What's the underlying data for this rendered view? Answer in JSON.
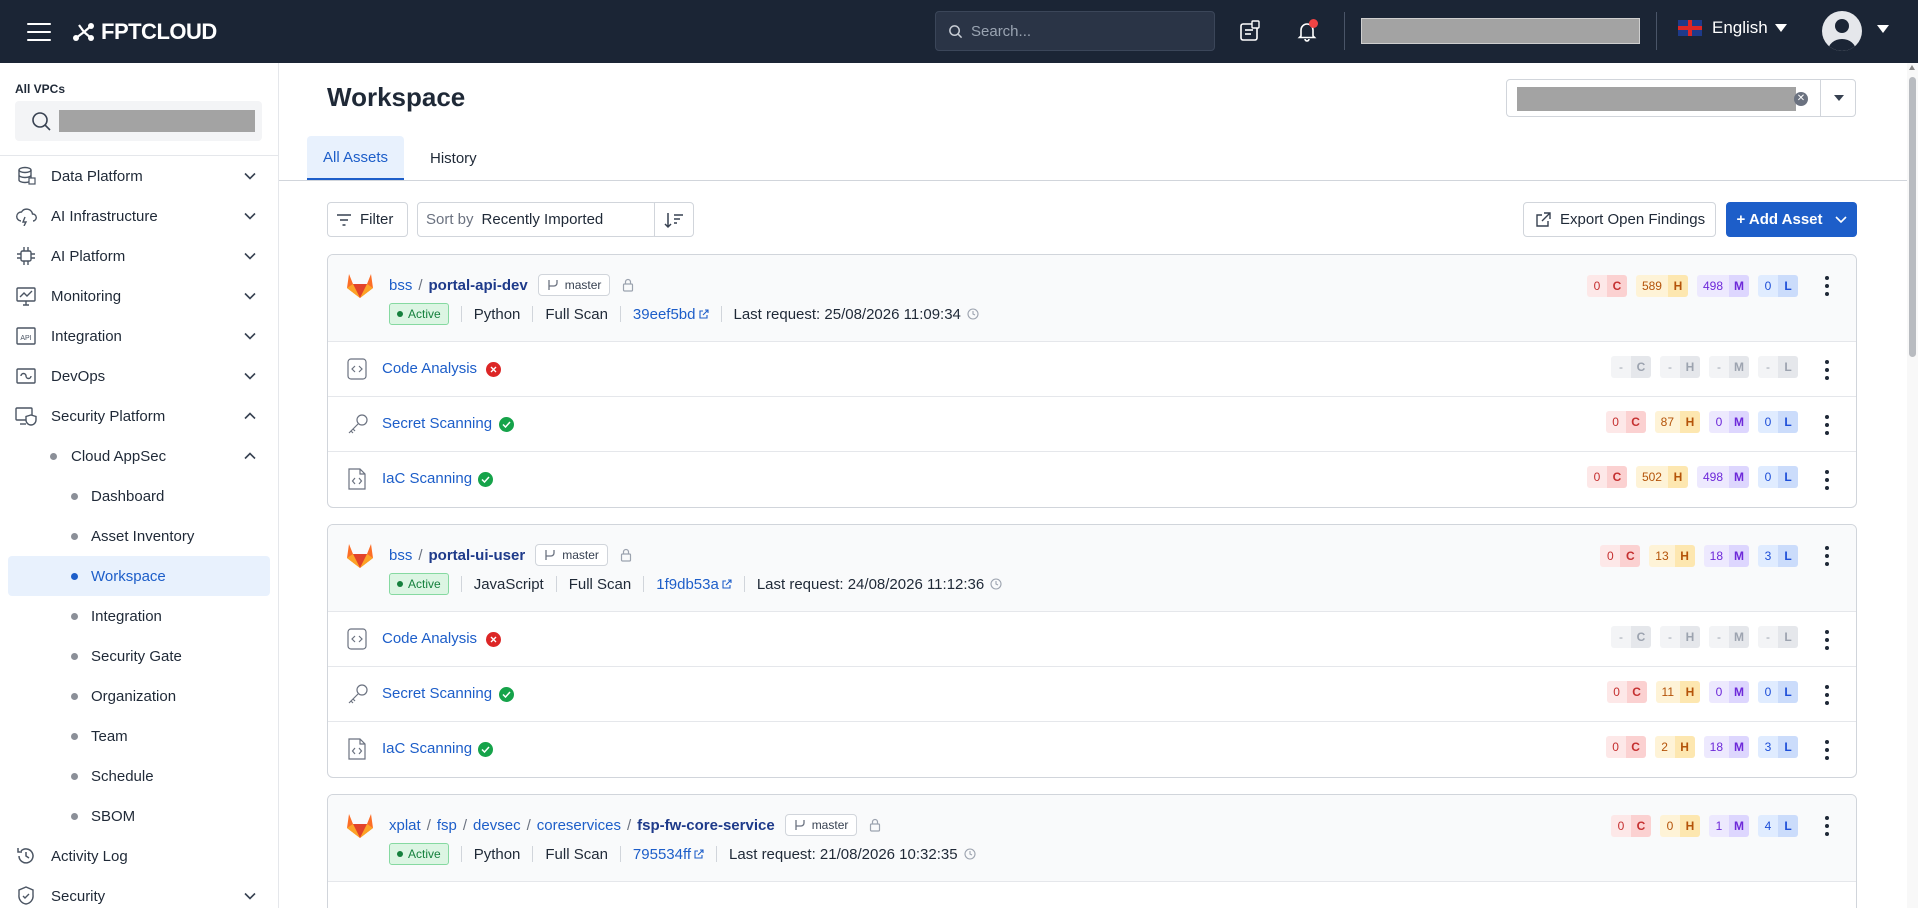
{
  "topbar": {
    "logo_text": "FPTCLOUD",
    "search_placeholder": "Search...",
    "language": "English"
  },
  "sidebar": {
    "vpc_label": "All VPCs",
    "items": [
      {
        "label": "Data Platform",
        "icon": "database-icon"
      },
      {
        "label": "AI Infrastructure",
        "icon": "cloud-ai-icon"
      },
      {
        "label": "AI Platform",
        "icon": "chip-icon"
      },
      {
        "label": "Monitoring",
        "icon": "monitor-chart-icon"
      },
      {
        "label": "Integration",
        "icon": "api-icon"
      },
      {
        "label": "DevOps",
        "icon": "devops-icon"
      },
      {
        "label": "Security Platform",
        "icon": "shield-monitor-icon"
      },
      {
        "label": "Cloud AppSec"
      },
      {
        "label": "Dashboard"
      },
      {
        "label": "Asset Inventory"
      },
      {
        "label": "Workspace"
      },
      {
        "label": "Integration"
      },
      {
        "label": "Security Gate"
      },
      {
        "label": "Organization"
      },
      {
        "label": "Team"
      },
      {
        "label": "Schedule"
      },
      {
        "label": "SBOM"
      },
      {
        "label": "Activity Log",
        "icon": "history-icon"
      },
      {
        "label": "Security",
        "icon": "shield-icon"
      }
    ]
  },
  "page": {
    "title": "Workspace",
    "tabs": [
      {
        "label": "All Assets"
      },
      {
        "label": "History"
      }
    ],
    "filter_label": "Filter",
    "sort_prefix": "Sort by",
    "sort_value": "Recently Imported",
    "export_label": "Export Open Findings",
    "add_asset_label": "+ Add Asset"
  },
  "assets": [
    {
      "org": "bss",
      "repo": "portal-api-dev",
      "branch": "master",
      "status": "Active",
      "language": "Python",
      "scan_type": "Full Scan",
      "commit": "39eef5bd",
      "last_request": "Last request: 25/08/2026 11:09:34",
      "totals": {
        "c": "0",
        "h": "589",
        "m": "498",
        "l": "0"
      },
      "scans": [
        {
          "name": "Code Analysis",
          "ok": false,
          "c": "-",
          "h": "-",
          "m": "-",
          "l": "-"
        },
        {
          "name": "Secret Scanning",
          "ok": true,
          "c": "0",
          "h": "87",
          "m": "0",
          "l": "0"
        },
        {
          "name": "IaC Scanning",
          "ok": true,
          "c": "0",
          "h": "502",
          "m": "498",
          "l": "0"
        }
      ]
    },
    {
      "org": "bss",
      "repo": "portal-ui-user",
      "branch": "master",
      "status": "Active",
      "language": "JavaScript",
      "scan_type": "Full Scan",
      "commit": "1f9db53a",
      "last_request": "Last request: 24/08/2026 11:12:36",
      "totals": {
        "c": "0",
        "h": "13",
        "m": "18",
        "l": "3"
      },
      "scans": [
        {
          "name": "Code Analysis",
          "ok": false,
          "c": "-",
          "h": "-",
          "m": "-",
          "l": "-"
        },
        {
          "name": "Secret Scanning",
          "ok": true,
          "c": "0",
          "h": "11",
          "m": "0",
          "l": "0"
        },
        {
          "name": "IaC Scanning",
          "ok": true,
          "c": "0",
          "h": "2",
          "m": "18",
          "l": "3"
        }
      ]
    },
    {
      "path": [
        "xplat",
        "fsp",
        "devsec",
        "coreservices"
      ],
      "repo": "fsp-fw-core-service",
      "branch": "master",
      "status": "Active",
      "language": "Python",
      "scan_type": "Full Scan",
      "commit": "795534ff",
      "last_request": "Last request: 21/08/2026 10:32:35",
      "totals": {
        "c": "0",
        "h": "0",
        "m": "1",
        "l": "4"
      }
    }
  ],
  "severity_keys": {
    "c": "C",
    "h": "H",
    "m": "M",
    "l": "L"
  },
  "colors": {
    "brand": "#1d5ec9",
    "topbar": "#1b2535",
    "active_green": "#16a34a",
    "error_red": "#dc2626"
  }
}
